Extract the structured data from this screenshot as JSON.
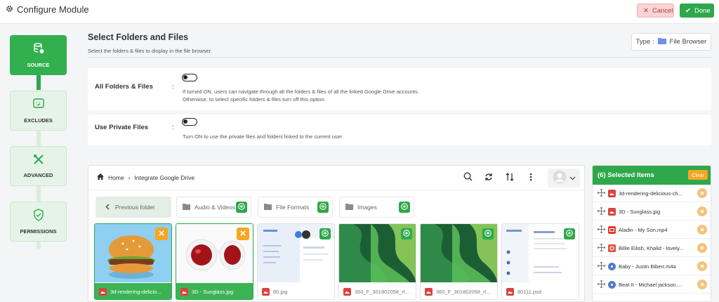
{
  "header": {
    "title": "Configure Module",
    "cancel_label": "Cancel",
    "done_label": "Done"
  },
  "steps": [
    {
      "label": "SOURCE",
      "icon": "database-icon"
    },
    {
      "label": "EXCLUDES",
      "icon": "exclude-icon"
    },
    {
      "label": "ADVANCED",
      "icon": "tools-icon"
    },
    {
      "label": "PERMISSIONS",
      "icon": "shield-icon"
    }
  ],
  "section": {
    "title": "Select Folders and Files",
    "description": "Select the folders & files to display in the file browser.",
    "type_label": "Type :",
    "type_value": "File Browser"
  },
  "options": [
    {
      "label": "All Folders & Files",
      "colon": ":",
      "help1": "If turned ON, users can navigate through all the folders & files of all the linked Google Drive accounts.",
      "help2": "Otherwise, to select specific folders & files turn off this option."
    },
    {
      "label": "Use Private Files",
      "colon": ":",
      "help1": "Turn ON to use the private files and folders linked to the current user."
    }
  ],
  "browser": {
    "breadcrumb": [
      "Home",
      "Integrate Google Drive"
    ],
    "previous_label": "Previous folder",
    "folders": [
      "Audio & Videos",
      "File Formats",
      "Images"
    ],
    "files": [
      {
        "name": "3d-rendering-delicio...",
        "selected": true
      },
      {
        "name": "3D - Sunglass.jpg",
        "selected": true
      },
      {
        "name": "80.jpg",
        "selected": false
      },
      {
        "name": "360_F_301802058_rl...",
        "selected": false
      },
      {
        "name": "360_F_301802058_rl...",
        "selected": false
      },
      {
        "name": "80111.psd",
        "selected": false
      }
    ]
  },
  "selected": {
    "title": "(6) Selected Items",
    "clear_label": "Clear",
    "items": [
      {
        "name": "3d-rendering-delicious-ch...",
        "icon": "image-icon"
      },
      {
        "name": "3D - Sunglass.jpg",
        "icon": "image-icon"
      },
      {
        "name": "Aladin - My Son.mp4",
        "icon": "video-icon"
      },
      {
        "name": "Billie Eilish, Khalid - lovely...",
        "icon": "audio-icon"
      },
      {
        "name": "Baby - Justin Biberr.m4a",
        "icon": "audio-icon"
      },
      {
        "name": "Beat It - Michael jackson....",
        "icon": "audio-icon"
      }
    ]
  },
  "colors": {
    "accent": "#2ea84a",
    "warning": "#f5a623",
    "danger": "#c0392b"
  }
}
